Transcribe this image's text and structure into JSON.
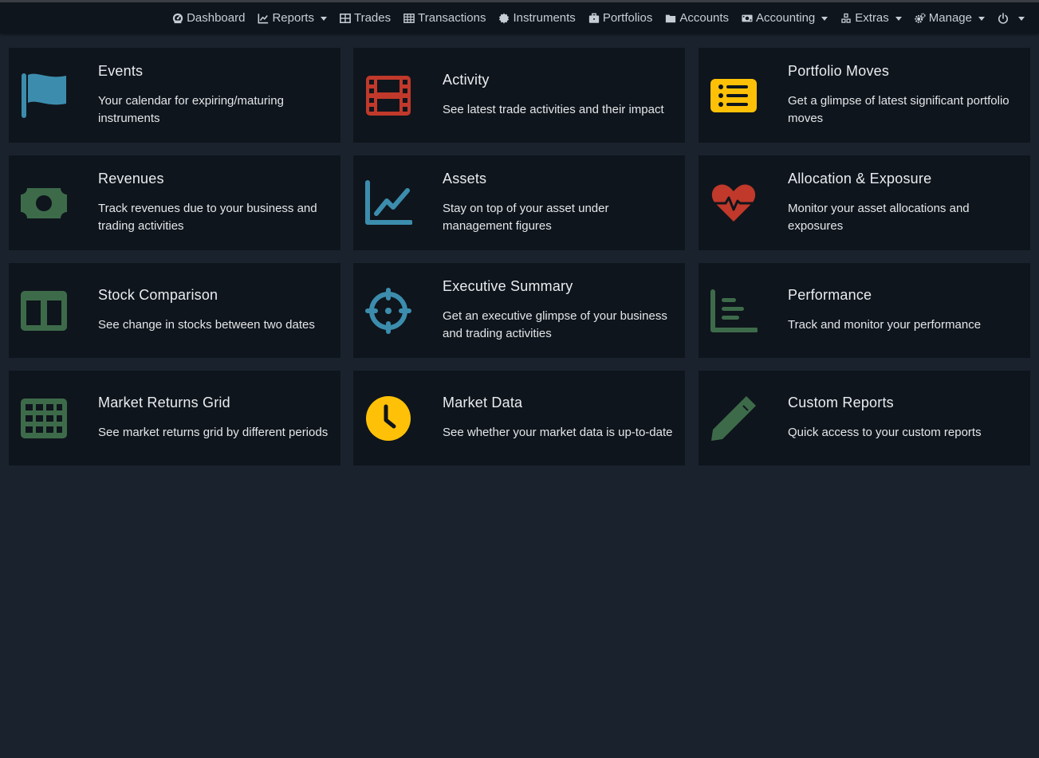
{
  "colors": {
    "page_background": "#1a222d",
    "navbar_background": "#0f151c",
    "card_background": "#0f151c",
    "blue": "#3c8dad",
    "red": "#c0392b",
    "yellow": "#ffc107",
    "green": "#3d6b4a"
  },
  "nav": {
    "items": [
      {
        "label": "Dashboard",
        "icon": "dashboard-icon",
        "dropdown": false
      },
      {
        "label": "Reports",
        "icon": "chart-line-icon",
        "dropdown": true
      },
      {
        "label": "Trades",
        "icon": "table-icon",
        "dropdown": false
      },
      {
        "label": "Transactions",
        "icon": "grid-table-icon",
        "dropdown": false
      },
      {
        "label": "Instruments",
        "icon": "certificate-icon",
        "dropdown": false
      },
      {
        "label": "Portfolios",
        "icon": "briefcase-icon",
        "dropdown": false
      },
      {
        "label": "Accounts",
        "icon": "folder-icon",
        "dropdown": false
      },
      {
        "label": "Accounting",
        "icon": "money-bill-icon",
        "dropdown": true
      },
      {
        "label": "Extras",
        "icon": "cubes-icon",
        "dropdown": true
      },
      {
        "label": "Manage",
        "icon": "cogs-icon",
        "dropdown": true
      },
      {
        "label": "",
        "icon": "power-icon",
        "dropdown": true
      }
    ]
  },
  "cards": [
    {
      "title": "Events",
      "description": "Your calendar for expiring/maturing instruments",
      "icon": "flag-icon",
      "color": "#3c8dad"
    },
    {
      "title": "Activity",
      "description": "See latest trade activities and their impact",
      "icon": "film-icon",
      "color": "#c0392b"
    },
    {
      "title": "Portfolio Moves",
      "description": "Get a glimpse of latest significant portfolio moves",
      "icon": "list-icon",
      "color": "#ffc107"
    },
    {
      "title": "Revenues",
      "description": "Track revenues due to your business and trading activities",
      "icon": "money-bill-icon",
      "color": "#3d6b4a"
    },
    {
      "title": "Assets",
      "description": "Stay on top of your asset under management figures",
      "icon": "chart-line-icon",
      "color": "#3c8dad"
    },
    {
      "title": "Allocation & Exposure",
      "description": "Monitor your asset allocations and exposures",
      "icon": "heartbeat-icon",
      "color": "#c0392b"
    },
    {
      "title": "Stock Comparison",
      "description": "See change in stocks between two dates",
      "icon": "columns-icon",
      "color": "#3d6b4a"
    },
    {
      "title": "Executive Summary",
      "description": "Get an executive glimpse of your business and trading activities",
      "icon": "crosshairs-icon",
      "color": "#3c8dad"
    },
    {
      "title": "Performance",
      "description": "Track and monitor your performance",
      "icon": "bar-chart-icon",
      "color": "#3d6b4a"
    },
    {
      "title": "Market Returns Grid",
      "description": "See market returns grid by different periods",
      "icon": "grid-icon",
      "color": "#3d6b4a"
    },
    {
      "title": "Market Data",
      "description": "See whether your market data is up-to-date",
      "icon": "clock-icon",
      "color": "#ffc107"
    },
    {
      "title": "Custom Reports",
      "description": "Quick access to your custom reports",
      "icon": "pencil-icon",
      "color": "#3d6b4a"
    }
  ]
}
